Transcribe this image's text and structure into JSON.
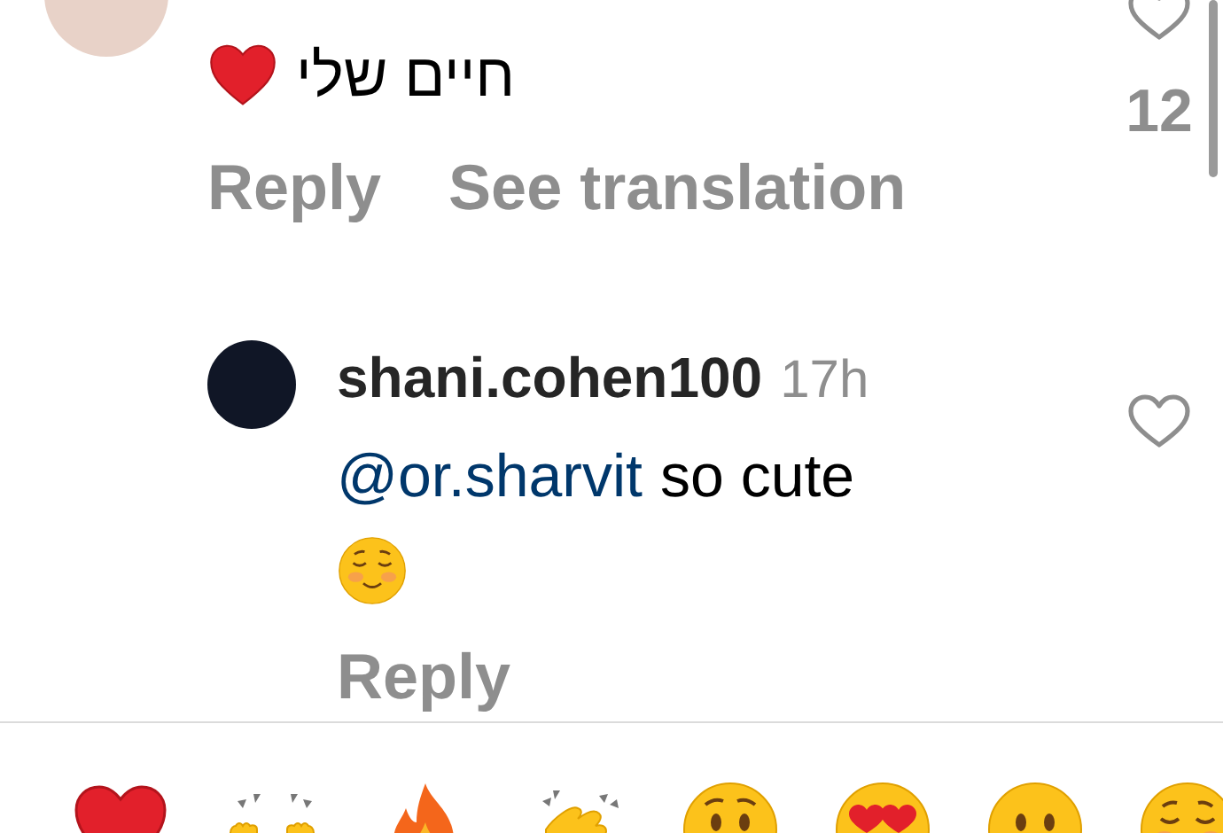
{
  "comments": [
    {
      "indent": false,
      "message": [
        {
          "kind": "text",
          "text": "חיים שלי"
        },
        {
          "kind": "heart"
        }
      ],
      "likes": "12",
      "actions": [
        "Reply",
        "See translation"
      ]
    },
    {
      "indent": true,
      "username": "shani.cohen100",
      "time": "17h",
      "message": [
        {
          "kind": "mention",
          "text": "@or.sharvit"
        },
        {
          "kind": "text",
          "text": "so cute"
        },
        {
          "kind": "blush"
        }
      ],
      "actions": [
        "Reply"
      ]
    }
  ],
  "reactions": [
    {
      "kind": "heart"
    },
    {
      "kind": "raised-hands"
    },
    {
      "kind": "fire"
    },
    {
      "kind": "clap"
    },
    {
      "kind": "hushed"
    },
    {
      "kind": "heart-eyes"
    },
    {
      "kind": "neutral"
    },
    {
      "kind": "blush"
    }
  ]
}
